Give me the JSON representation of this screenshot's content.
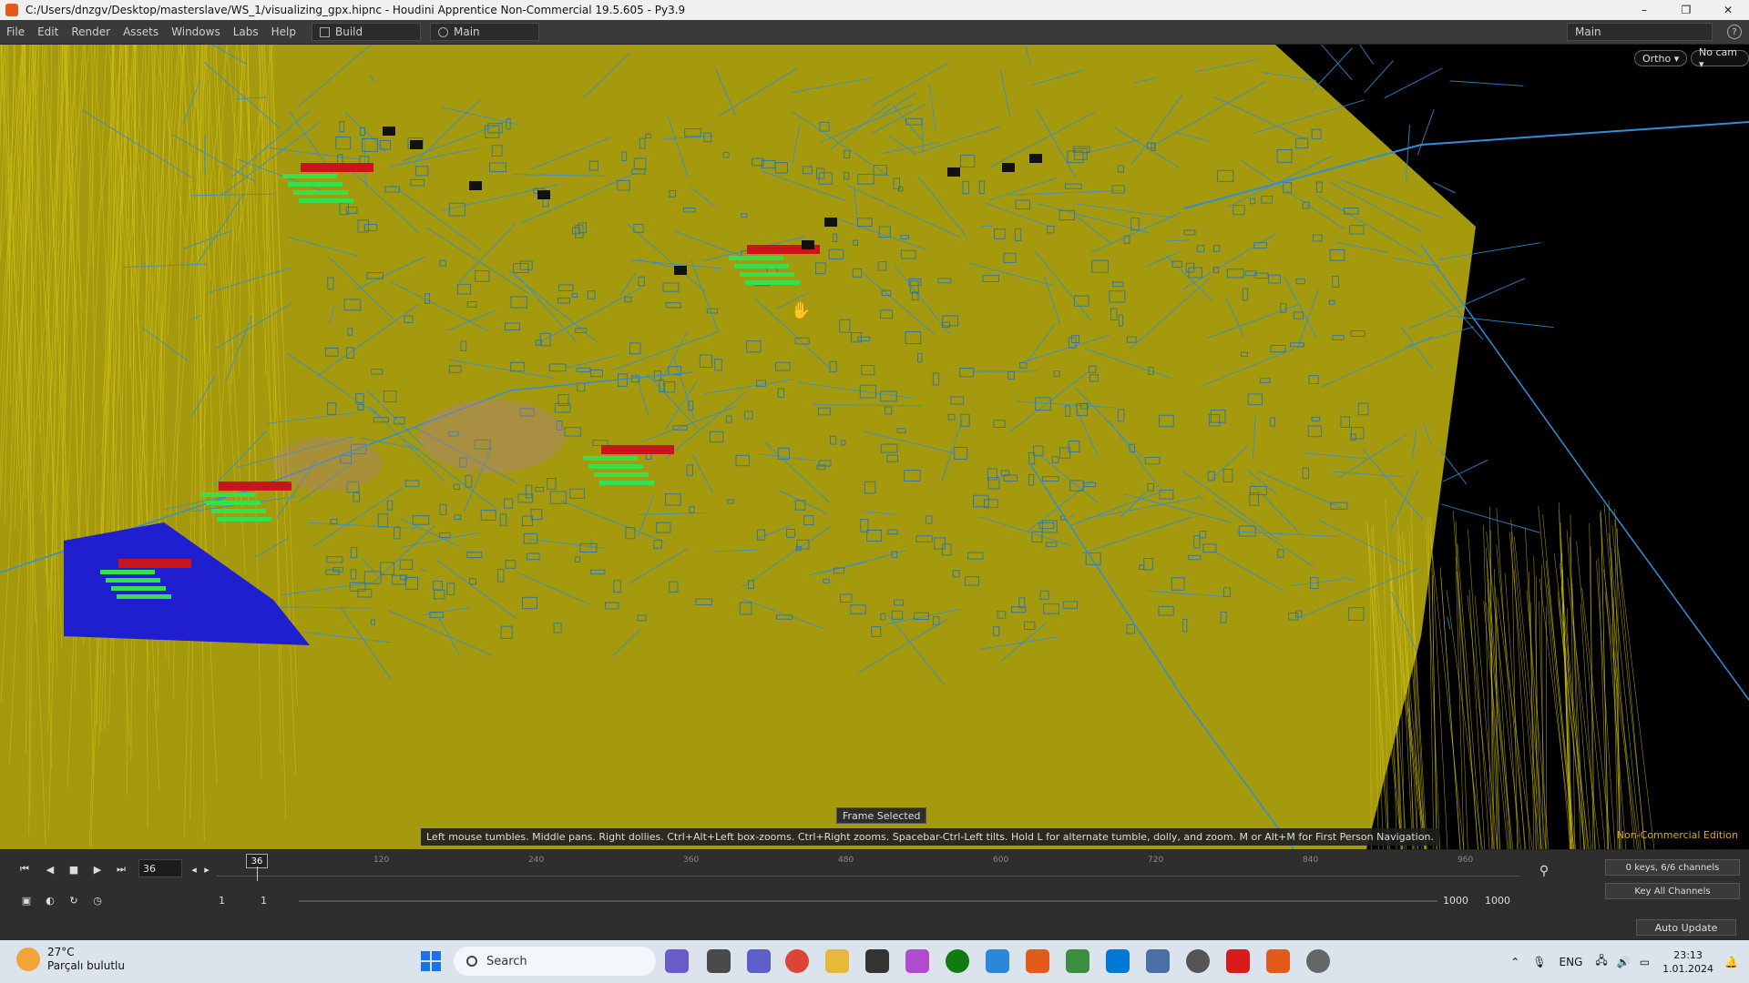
{
  "window": {
    "title": "C:/Users/dnzgv/Desktop/masterslave/WS_1/visualizing_gpx.hipnc - Houdini Apprentice Non-Commercial 19.5.605 - Py3.9",
    "minimize": "–",
    "maximize": "❐",
    "close": "✕"
  },
  "menu": {
    "items": [
      "File",
      "Edit",
      "Render",
      "Assets",
      "Windows",
      "Labs",
      "Help"
    ],
    "desktop_build": "Build",
    "desktop_main": "Main",
    "right_desktop": "Main",
    "help": "?"
  },
  "viewport": {
    "ortho_label": "Ortho ▾",
    "camera_label": "No cam ▾",
    "frame_selected": "Frame Selected",
    "hint": "Left mouse tumbles. Middle pans. Right dollies. Ctrl+Alt+Left box-zooms. Ctrl+Right zooms. Spacebar-Ctrl-Left tilts. Hold L for alternate tumble, dolly, and zoom.   M or Alt+M for First Person Navigation.",
    "edition": "Non-Commercial Edition",
    "colors": {
      "ground": "#a59a0e",
      "lines": "#2f8fd8",
      "dense": "#1a6fc0",
      "yellow_streaks": "#d4c418",
      "label_green": "#36e04a",
      "label_red": "#c8141a",
      "deep_blue": "#1f1fd0"
    }
  },
  "timeline": {
    "current_frame": "36",
    "marker": "36",
    "ticks": [
      "120",
      "240",
      "360",
      "480",
      "600",
      "720",
      "840",
      "960"
    ],
    "range_start": "1",
    "range_start2": "1",
    "range_end": "1000",
    "range_end2": "1000",
    "keys_info": "0 keys, 6/6 channels",
    "key_all": "Key All Channels",
    "auto_update": "Auto Update"
  },
  "taskbar": {
    "weather_temp": "27°C",
    "weather_desc": "Parçalı bulutlu",
    "search": "Search",
    "lang": "ENG",
    "time": "23:13",
    "date": "1.01.2024"
  }
}
